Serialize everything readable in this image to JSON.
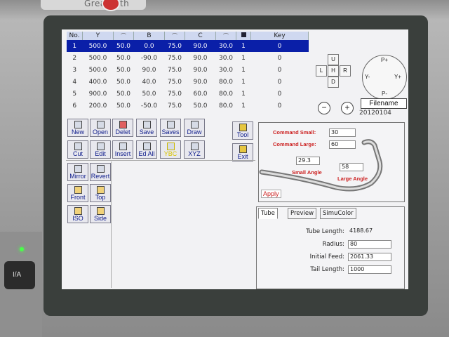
{
  "device": {
    "brand": "GreatPath"
  },
  "table": {
    "columns": [
      "No.",
      "Y",
      "",
      "B",
      "",
      "C",
      "",
      "",
      "Key"
    ],
    "rows": [
      [
        "1",
        "500.0",
        "50.0",
        "0.0",
        "75.0",
        "90.0",
        "30.0",
        "1",
        "0"
      ],
      [
        "2",
        "500.0",
        "50.0",
        "-90.0",
        "75.0",
        "90.0",
        "30.0",
        "1",
        "0"
      ],
      [
        "3",
        "500.0",
        "50.0",
        "90.0",
        "75.0",
        "90.0",
        "30.0",
        "1",
        "0"
      ],
      [
        "4",
        "400.0",
        "50.0",
        "40.0",
        "75.0",
        "90.0",
        "80.0",
        "1",
        "0"
      ],
      [
        "5",
        "900.0",
        "50.0",
        "50.0",
        "75.0",
        "60.0",
        "80.0",
        "1",
        "0"
      ],
      [
        "6",
        "200.0",
        "50.0",
        "-50.0",
        "75.0",
        "50.0",
        "80.0",
        "1",
        "0"
      ]
    ],
    "selected_row": 0
  },
  "dpad": {
    "up": "U",
    "down": "D",
    "left": "L",
    "right": "R",
    "home": "H"
  },
  "axis_pad": {
    "p_plus": "P+",
    "p_minus": "P-",
    "y_plus": "Y+",
    "y_minus": "Y-"
  },
  "zoom": {
    "out": "−",
    "in": "+"
  },
  "file": {
    "label": "Filename",
    "value": "20120104"
  },
  "toolbar": {
    "new": "New",
    "open": "Open",
    "delet": "Delet",
    "save": "Save",
    "saves": "Saves",
    "draw": "Draw",
    "cut": "Cut",
    "edit": "Edit",
    "insert": "Insert",
    "ed_all": "Ed All",
    "ybc": "YBC",
    "xyz": "XYZ",
    "tool": "Tool",
    "exit": "Exit",
    "mirror": "Mirror",
    "revert": "Revert",
    "front": "Front",
    "top": "Top",
    "iso": "ISO",
    "side": "Side"
  },
  "bend": {
    "command_small_label": "Command Small:",
    "command_small_value": "30",
    "command_large_label": "Command Large:",
    "command_large_value": "60",
    "small_angle_value": "29.3",
    "small_angle_label": "Small Angle",
    "large_angle_value": "58",
    "large_angle_label": "Large Angle",
    "apply": "Apply"
  },
  "tube": {
    "tabs": [
      "Tube",
      "Preview",
      "SimuColor"
    ],
    "length_label": "Tube Length:",
    "length_value": "4188.67",
    "radius_label": "Radius:",
    "radius_value": "80",
    "feed_label": "Initial Feed:",
    "feed_value": "2061.33",
    "tail_label": "Tail Length:",
    "tail_value": "1000"
  },
  "side_button": {
    "label": "I/A"
  }
}
